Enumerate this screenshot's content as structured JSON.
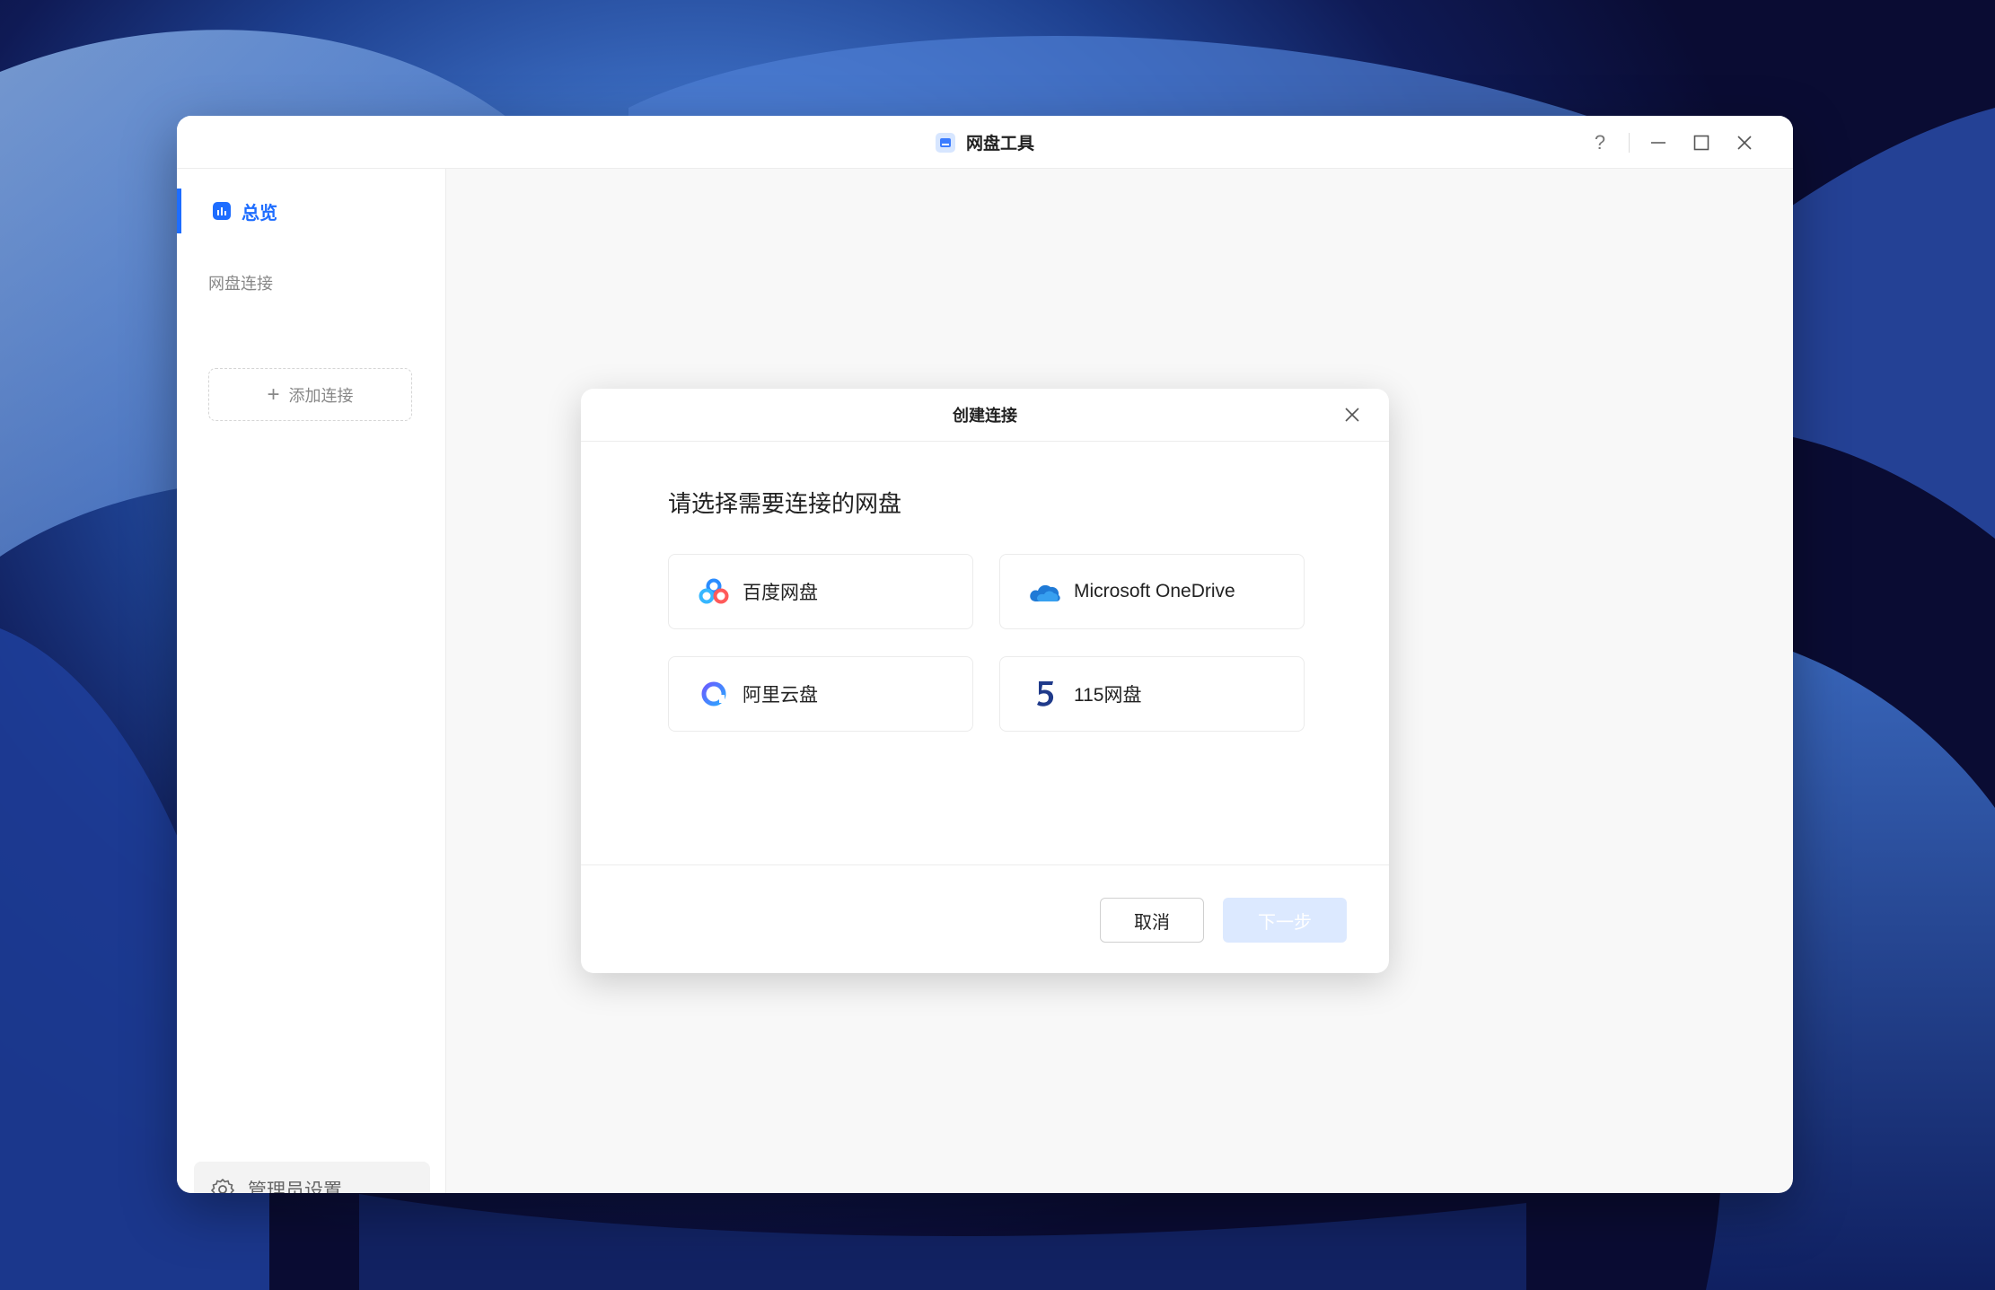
{
  "window": {
    "title": "网盘工具",
    "controls": {
      "help_label": "?"
    }
  },
  "sidebar": {
    "overview_label": "总览",
    "section_label": "网盘连接",
    "add_connection_label": "添加连接",
    "admin_settings_label": "管理员设置"
  },
  "dialog": {
    "title": "创建连接",
    "prompt": "请选择需要连接的网盘",
    "providers": [
      {
        "label": "百度网盘",
        "icon": "baidu-netdisk-icon"
      },
      {
        "label": "Microsoft OneDrive",
        "icon": "onedrive-icon"
      },
      {
        "label": "阿里云盘",
        "icon": "aliyun-drive-icon"
      },
      {
        "label": "115网盘",
        "icon": "115-drive-icon"
      }
    ],
    "cancel_label": "取消",
    "next_label": "下一步"
  },
  "colors": {
    "accent": "#1e6dff",
    "next_disabled": "#dce9ff"
  }
}
